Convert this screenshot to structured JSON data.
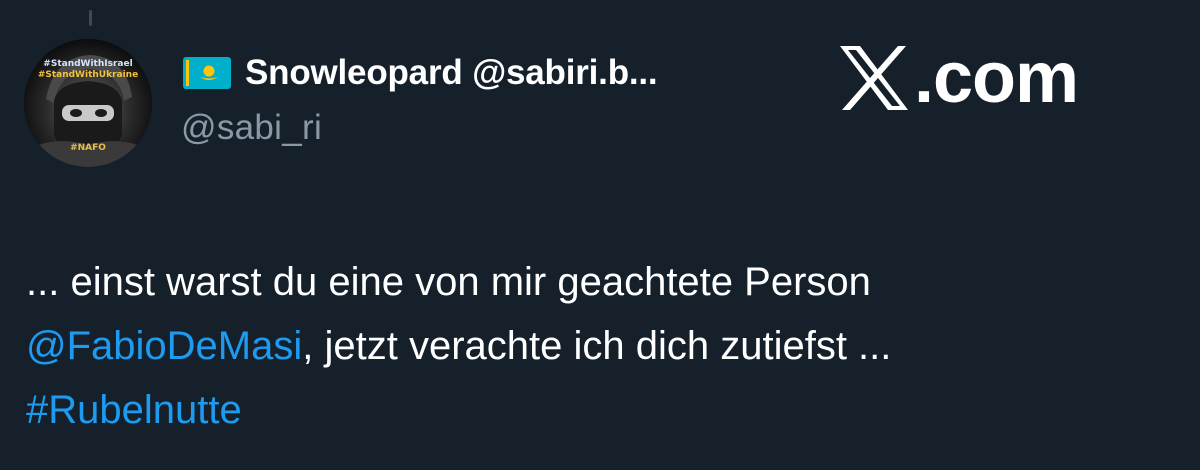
{
  "author": {
    "display_name": "Snowleopard @sabiri.b...",
    "handle": "@sabi_ri",
    "flag_icon": "kazakhstan-flag-icon",
    "avatar": {
      "badge_line1": "#StandWithIsrael",
      "badge_line2": "#StandWithUkraine",
      "badge_line3": "#NAFO"
    }
  },
  "brand": {
    "icon": "x-logo-icon",
    "label": ".com"
  },
  "tweet": {
    "line1": "... einst warst du eine von mir geachtete Person",
    "mention": "@FabioDeMasi",
    "line2_rest": ", jetzt verachte ich dich zutiefst ...",
    "hashtag": "#Rubelnutte"
  },
  "colors": {
    "background": "#15202b",
    "link": "#1d9bf0",
    "secondary_text": "#8b98a5",
    "flag_blue": "#00afca",
    "flag_gold": "#fec50c"
  }
}
